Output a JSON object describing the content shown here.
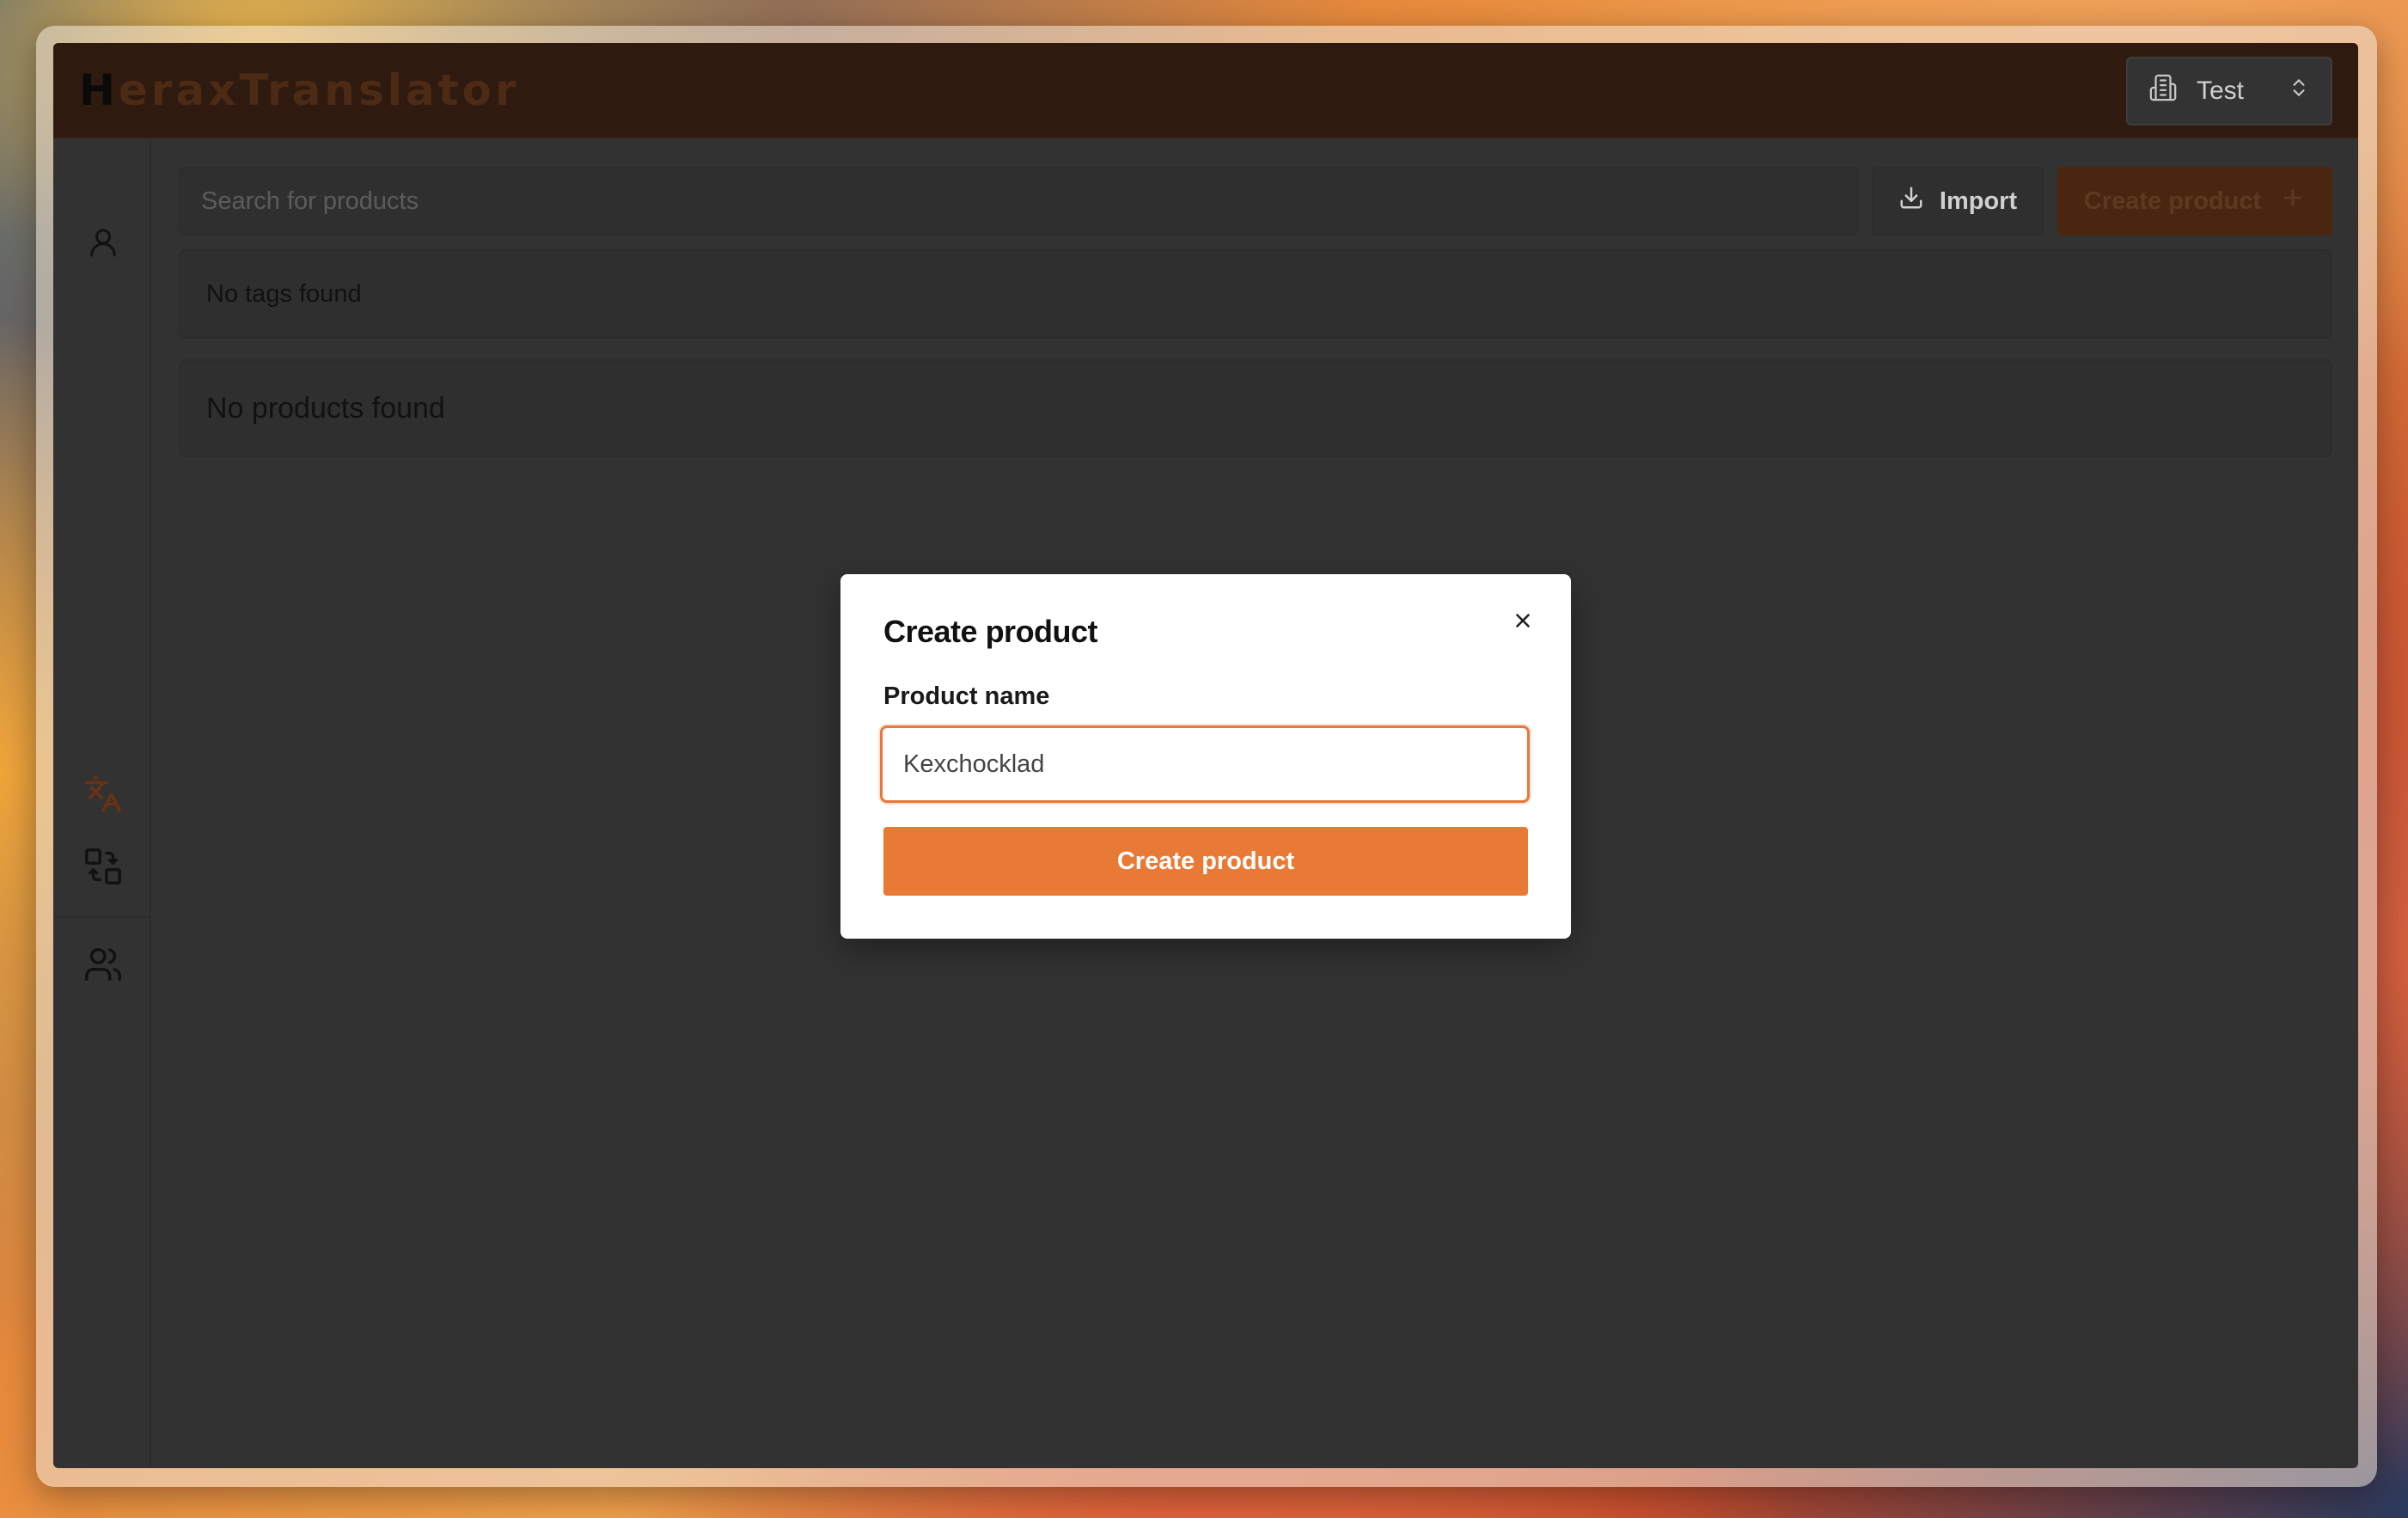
{
  "app": {
    "logo_first": "H",
    "logo_rest": "eraxTranslator"
  },
  "org_select": {
    "label": "Test"
  },
  "toolbar": {
    "search_placeholder": "Search for products",
    "import_label": "Import",
    "create_label": "Create product"
  },
  "tags": {
    "empty_text": "No tags found"
  },
  "products": {
    "empty_text": "No products found"
  },
  "modal": {
    "title": "Create product",
    "field_label": "Product name",
    "field_value": "Kexchocklad",
    "submit_label": "Create product"
  },
  "colors": {
    "accent": "#e97a36",
    "topbar": "#2e1a0f",
    "background": "#323232"
  },
  "icons": [
    "building-icon",
    "chevron-updown-icon",
    "user-icon",
    "translate-icon",
    "qr-swap-icon",
    "users-icon",
    "download-icon",
    "plus-icon",
    "close-icon"
  ]
}
